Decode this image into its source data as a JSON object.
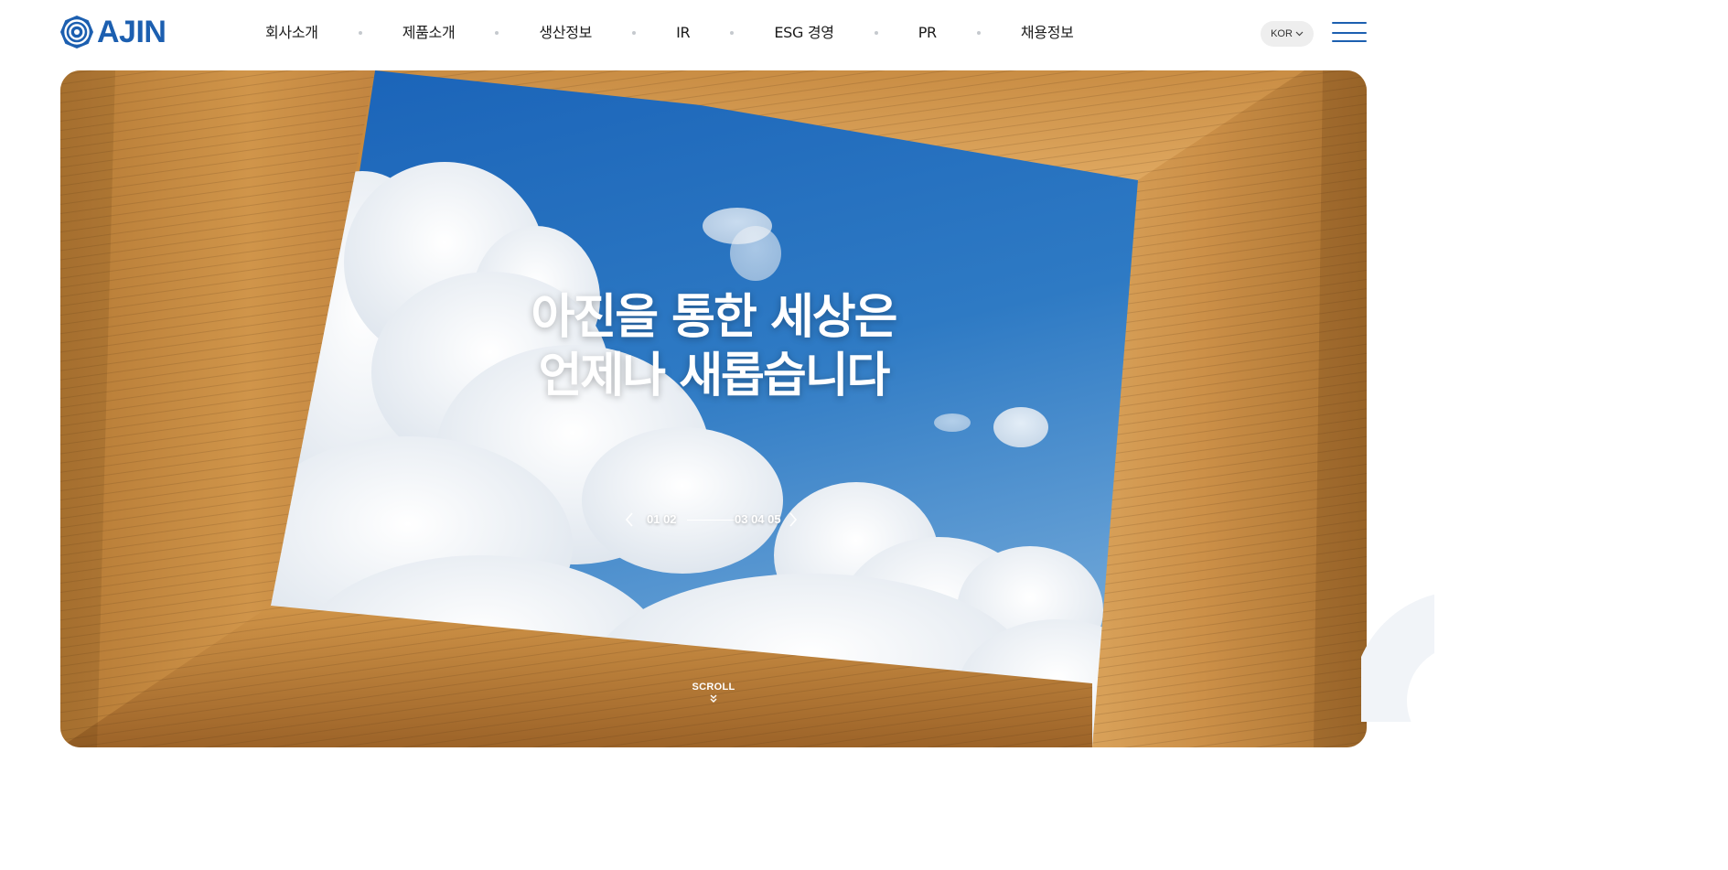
{
  "header": {
    "logo_text": "AJIN",
    "nav": [
      "회사소개",
      "제품소개",
      "생산정보",
      "IR",
      "ESG 경영",
      "PR",
      "채용정보"
    ],
    "language": "KOR",
    "menu_icon": "hamburger-menu-icon",
    "brand_color": "#1c5fb0"
  },
  "hero": {
    "title_line1": "아진을 통한 세상은",
    "title_line2": "언제나 새롭습니다",
    "pager": {
      "prev_icon": "chevron-left-icon",
      "next_icon": "chevron-right-icon",
      "before": "01 02",
      "after": "03 04 05"
    },
    "scroll_label": "SCROLL",
    "scroll_icon": "double-chevron-down-icon"
  }
}
